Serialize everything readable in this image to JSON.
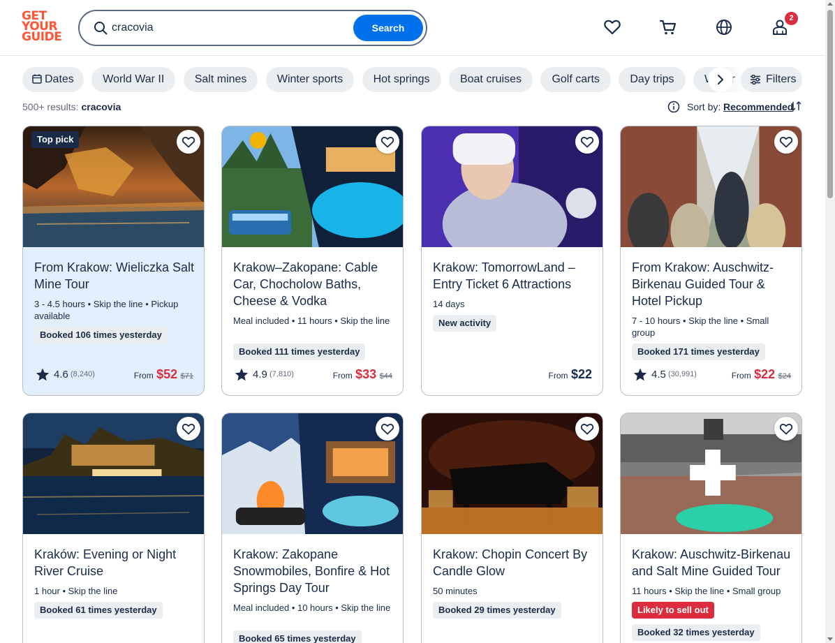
{
  "header": {
    "logo_lines": [
      "GET",
      "YOUR",
      "GUIDE"
    ],
    "search_value": "cracovia",
    "search_button": "Search",
    "cart_badge": "2"
  },
  "chips": {
    "dates": "Dates",
    "items": [
      "World War II",
      "Salt mines",
      "Winter sports",
      "Hot springs",
      "Boat cruises",
      "Golf carts",
      "Day trips"
    ],
    "partial": "Walkir",
    "filters": "Filters"
  },
  "results": {
    "count": "500+ results:",
    "query": "cracovia",
    "sort_label": "Sort by:",
    "sort_value": "Recommended"
  },
  "cards": [
    {
      "tag": "Top pick",
      "title": "From Krakow: Wieliczka Salt Mine Tour",
      "meta": "3 - 4.5 hours • Skip the line • Pickup available",
      "pill": "Booked 106 times yesterday",
      "rating": "4.6",
      "reviews": "(8,240)",
      "from": "From",
      "price": "$52",
      "old_price": "$71"
    },
    {
      "title": "Krakow–Zakopane: Cable Car, Chocholow Baths, Cheese & Vodka",
      "meta": "Meal included • 11 hours • Skip the line",
      "pill": "Booked 111 times yesterday",
      "rating": "4.9",
      "reviews": "(7,810)",
      "from": "From",
      "price": "$33",
      "old_price": "$44"
    },
    {
      "title": "Krakow: TomorrowLand – Entry Ticket 6 Attractions",
      "meta": "14 days",
      "pill": "New activity",
      "from": "From",
      "price": "$22"
    },
    {
      "title": "From Krakow: Auschwitz-Birkenau Guided Tour & Hotel Pickup",
      "meta": "7 - 10 hours • Skip the line • Small group",
      "pill": "Booked 171 times yesterday",
      "rating": "4.5",
      "reviews": "(30,991)",
      "from": "From",
      "price": "$22",
      "old_price": "$24"
    },
    {
      "title": "Kraków: Evening or Night River Cruise",
      "meta": "1 hour • Skip the line",
      "pill": "Booked 61 times yesterday"
    },
    {
      "title": "Krakow: Zakopane Snowmobiles, Bonfire & Hot Springs Day Tour",
      "meta": "Meal included • 10 hours • Skip the line",
      "pill": "Booked 65 times yesterday"
    },
    {
      "title": "Krakow: Chopin Concert By Candle Glow",
      "meta": "50 minutes",
      "pill": "Booked 29 times yesterday"
    },
    {
      "title": "Krakow: Auschwitz-Birkenau and Salt Mine Guided Tour",
      "meta": "11 hours • Skip the line • Small group",
      "pill_red": "Likely to sell out",
      "pill": "Booked 32 times yesterday"
    }
  ],
  "colors": {
    "brand": "#ff5533",
    "accent": "#0071eb",
    "sale": "#dc2c3e",
    "ink": "#1a2b49"
  },
  "icons": [
    "search-icon",
    "heart-icon",
    "cart-icon",
    "globe-icon",
    "profile-icon",
    "calendar-icon",
    "chevron-right-icon",
    "filters-icon",
    "info-icon",
    "sort-icon",
    "star-icon"
  ]
}
